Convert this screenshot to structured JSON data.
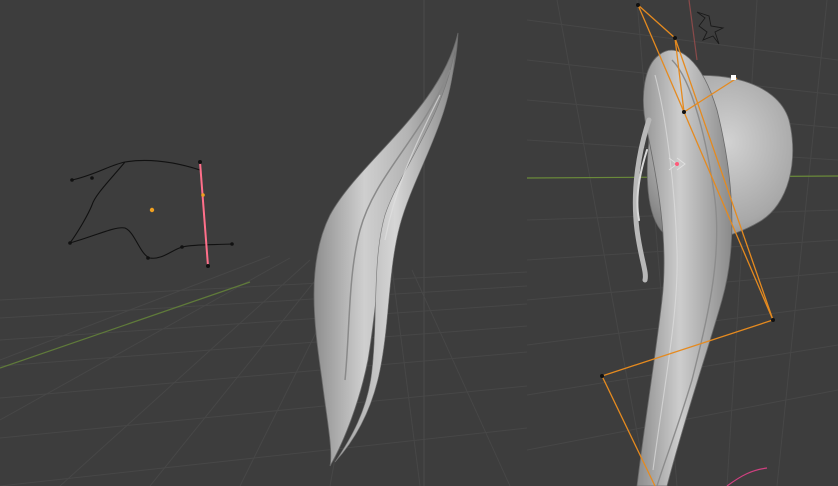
{
  "app": {
    "name": "3D viewport"
  },
  "viewports": [
    {
      "name": "left-viewport",
      "objects": [
        "profile-curve",
        "curve-origin",
        "hair-strand-mesh"
      ]
    },
    {
      "name": "right-viewport",
      "objects": [
        "head-mesh",
        "ponytail-mesh",
        "armature",
        "empty-object"
      ]
    }
  ],
  "colors": {
    "viewport_bg": "#3d3d3d",
    "grid": "#474747",
    "grid_major": "#4c4c4c",
    "x_axis": "#8a4a4a",
    "y_axis": "#6a8a3a",
    "mesh": "#bdbdbd",
    "curve": "#111111",
    "origin": "#f0a020",
    "selection": "#ff5a7a",
    "armature": "#e58a1f"
  }
}
